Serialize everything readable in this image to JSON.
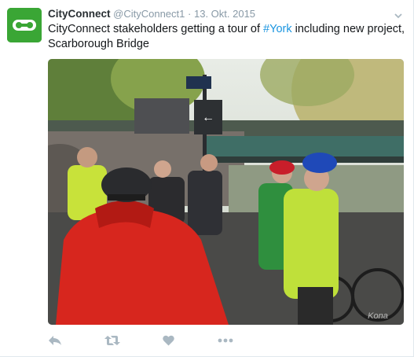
{
  "tweet": {
    "display_name": "CityConnect",
    "handle": "@CityConnect1",
    "separator": "·",
    "timestamp": "13. Okt. 2015",
    "text_before": "CityConnect stakeholders getting a tour of ",
    "hashtag": "#York",
    "text_after": " including new project, Scarborough Bridge",
    "photo_sign_text": "←",
    "photo_watermark": "Kona"
  },
  "actions": {
    "reply_icon": "reply-icon",
    "retweet_icon": "retweet-icon",
    "like_icon": "heart-icon",
    "more_icon": "more-icon"
  },
  "colors": {
    "brand_green": "#3aa635",
    "icon_gray": "#aab8c2",
    "link_blue": "#1b95e0"
  }
}
